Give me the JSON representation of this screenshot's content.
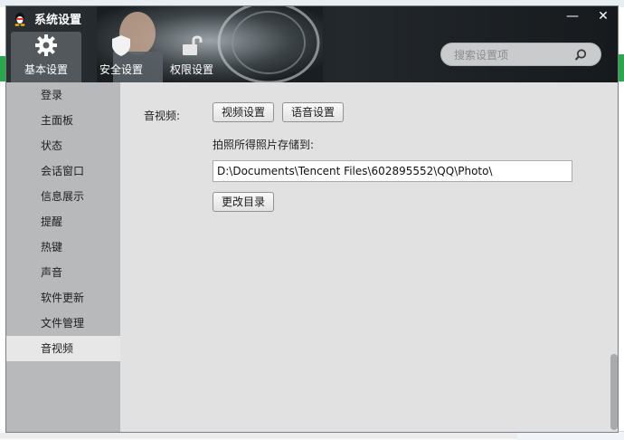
{
  "window": {
    "title": "系统设置",
    "minimize_glyph": "—",
    "close_glyph": "✕"
  },
  "tabs": [
    {
      "label": "基本设置",
      "icon": "gear-icon",
      "active": true
    },
    {
      "label": "安全设置",
      "icon": "shield-icon",
      "active": false
    },
    {
      "label": "权限设置",
      "icon": "lock-icon",
      "active": false
    }
  ],
  "search": {
    "placeholder": "搜索设置项",
    "value": ""
  },
  "sidebar": {
    "items": [
      {
        "label": "登录"
      },
      {
        "label": "主面板"
      },
      {
        "label": "状态"
      },
      {
        "label": "会话窗口"
      },
      {
        "label": "信息展示"
      },
      {
        "label": "提醒"
      },
      {
        "label": "热键"
      },
      {
        "label": "声音"
      },
      {
        "label": "软件更新"
      },
      {
        "label": "文件管理"
      },
      {
        "label": "音视频",
        "active": true
      }
    ]
  },
  "main": {
    "section_label": "音视频:",
    "video_settings_button": "视频设置",
    "voice_settings_button": "语音设置",
    "photo_path_label": "拍照所得照片存储到:",
    "photo_path_value": "D:\\Documents\\Tencent Files\\602895552\\QQ\\Photo\\",
    "change_dir_button": "更改目录"
  },
  "colors": {
    "header_bg": "#1c2024",
    "sidebar_bg": "#b8b9ba",
    "active_item_bg": "#e7e7e7",
    "content_bg": "#e1e1e1"
  }
}
